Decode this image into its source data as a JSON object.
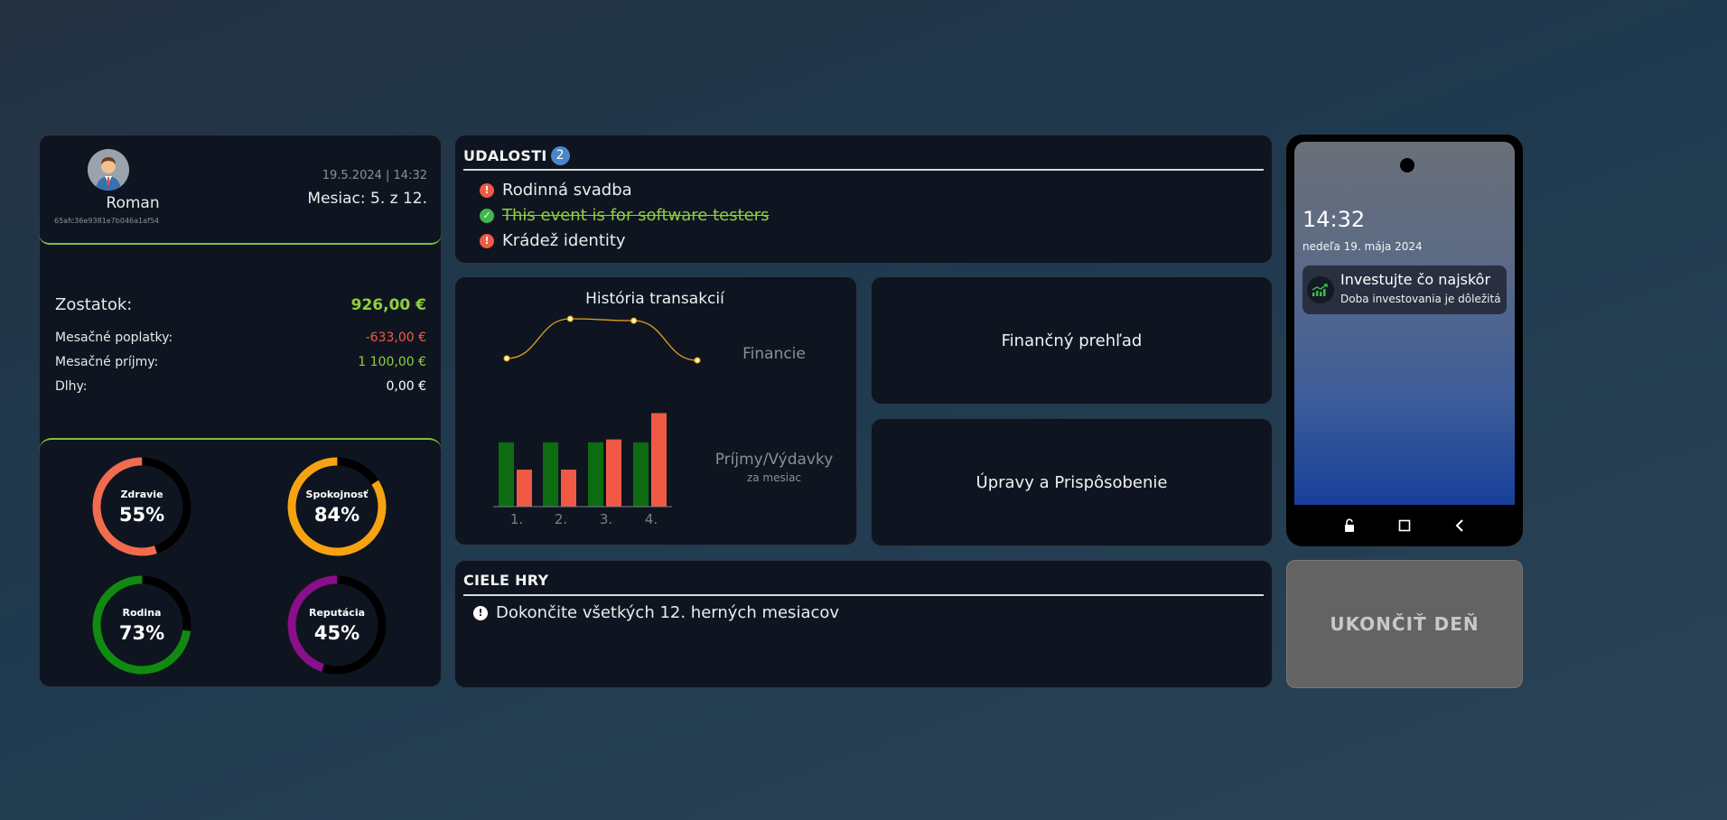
{
  "profile": {
    "name": "Roman",
    "id": "65afc36e9381e7b046a1af54",
    "datetime": "19.5.2024 | 14:32",
    "month": "Mesiac: 5. z 12.",
    "balance_label": "Zostatok:",
    "balance_value": "926,00 €",
    "fees_label": "Mesačné poplatky:",
    "fees_value": "-633,00 €",
    "income_label": "Mesačné príjmy:",
    "income_value": "1 100,00 €",
    "debts_label": "Dlhy:",
    "debts_value": "0,00 €",
    "colors": {
      "positive": "#8fcf3c",
      "negative": "#f05a45",
      "accent": "#7cc041"
    }
  },
  "stats": [
    {
      "name": "Zdravie",
      "value": "55%",
      "fraction": 0.55,
      "color": "#f26b4f"
    },
    {
      "name": "Spokojnosť",
      "value": "84%",
      "fraction": 0.84,
      "color": "#f6a312"
    },
    {
      "name": "Rodina",
      "value": "73%",
      "fraction": 0.73,
      "color": "#118a11"
    },
    {
      "name": "Reputácia",
      "value": "45%",
      "fraction": 0.45,
      "color": "#8a0f8a"
    }
  ],
  "events": {
    "title": "UDALOSTI",
    "count": "2",
    "items": [
      {
        "label": "Rodinná svadba",
        "status": "alert",
        "icon": "exclamation-icon"
      },
      {
        "label": "This event is for software testers",
        "status": "done",
        "icon": "check-icon"
      },
      {
        "label": "Krádež identity",
        "status": "alert",
        "icon": "exclamation-icon"
      }
    ]
  },
  "history": {
    "title": "História transakcií",
    "line_label": "Financie",
    "bar_label": "Príjmy/Výdavky",
    "bar_sublabel": "za mesiac"
  },
  "chart_data": [
    {
      "type": "line",
      "title": "Financie",
      "x": [
        1,
        2,
        3,
        4
      ],
      "values": [
        20,
        62,
        60,
        18
      ],
      "color": "#e0a020"
    },
    {
      "type": "bar",
      "title": "Príjmy/Výdavky",
      "categories": [
        "1.",
        "2.",
        "3.",
        "4."
      ],
      "series": [
        {
          "values": [
            1100,
            1100,
            1100,
            1100
          ],
          "color": "#0d6b12"
        },
        {
          "values": [
            633,
            633,
            1150,
            1600
          ],
          "color": "#f05a45"
        }
      ],
      "ylim": [
        0,
        1700
      ]
    }
  ],
  "tiles": {
    "overview": "Finančný prehľad",
    "settings": "Úpravy a Prispôsobenie"
  },
  "goals": {
    "title": "CIELE HRY",
    "items": [
      {
        "label": "Dokončite všetkých 12. herných mesiacov",
        "icon": "exclamation-icon"
      }
    ]
  },
  "phone": {
    "time": "14:32",
    "date": "nedeľa 19. mája 2024",
    "notification_title": "Investujte čo najskôr",
    "notification_body": "Doba investovania je dôležitá"
  },
  "end_day": "UKONČIŤ DEŇ"
}
